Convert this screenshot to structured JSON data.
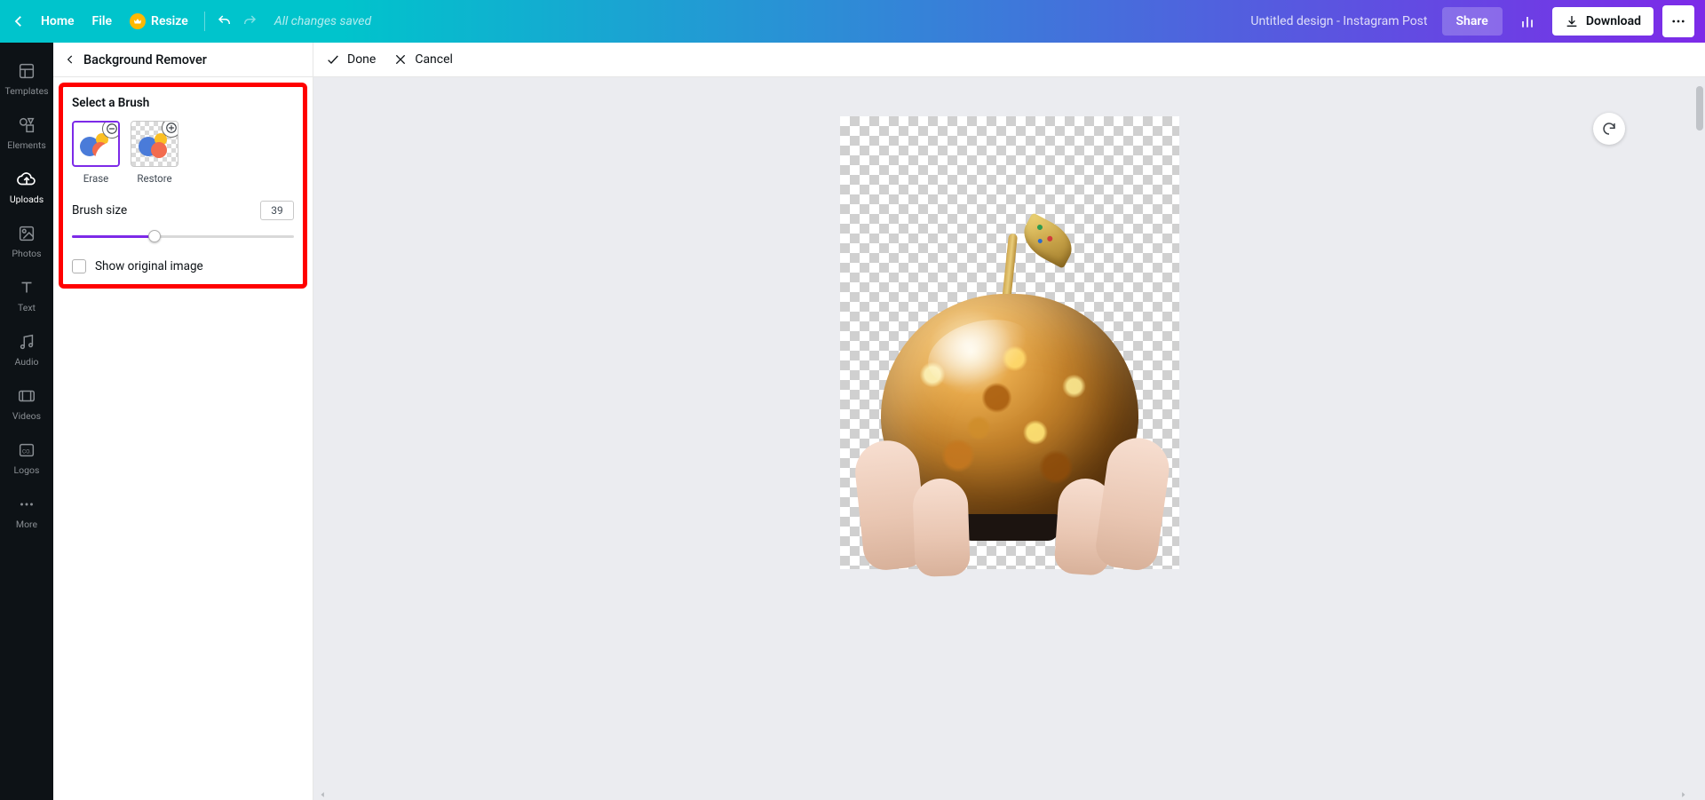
{
  "topbar": {
    "home": "Home",
    "file": "File",
    "resize": "Resize",
    "status": "All changes saved",
    "doc_title": "Untitled design - Instagram Post",
    "share": "Share",
    "download": "Download"
  },
  "leftnav": {
    "items": [
      {
        "label": "Templates",
        "icon": "templates-icon"
      },
      {
        "label": "Elements",
        "icon": "elements-icon"
      },
      {
        "label": "Uploads",
        "icon": "uploads-icon"
      },
      {
        "label": "Photos",
        "icon": "photos-icon"
      },
      {
        "label": "Text",
        "icon": "text-icon"
      },
      {
        "label": "Audio",
        "icon": "audio-icon"
      },
      {
        "label": "Videos",
        "icon": "videos-icon"
      },
      {
        "label": "Logos",
        "icon": "logos-icon"
      },
      {
        "label": "More",
        "icon": "more-icon"
      }
    ],
    "active_index": 2
  },
  "panel": {
    "title": "Background Remover",
    "section_title": "Select a Brush",
    "brushes": {
      "erase": "Erase",
      "restore": "Restore",
      "selected": "erase"
    },
    "brush_size_label": "Brush size",
    "brush_size_value": "39",
    "brush_size_min": 0,
    "brush_size_max": 100,
    "show_original_label": "Show original image",
    "show_original_checked": false
  },
  "subtoolbar": {
    "done": "Done",
    "cancel": "Cancel"
  }
}
